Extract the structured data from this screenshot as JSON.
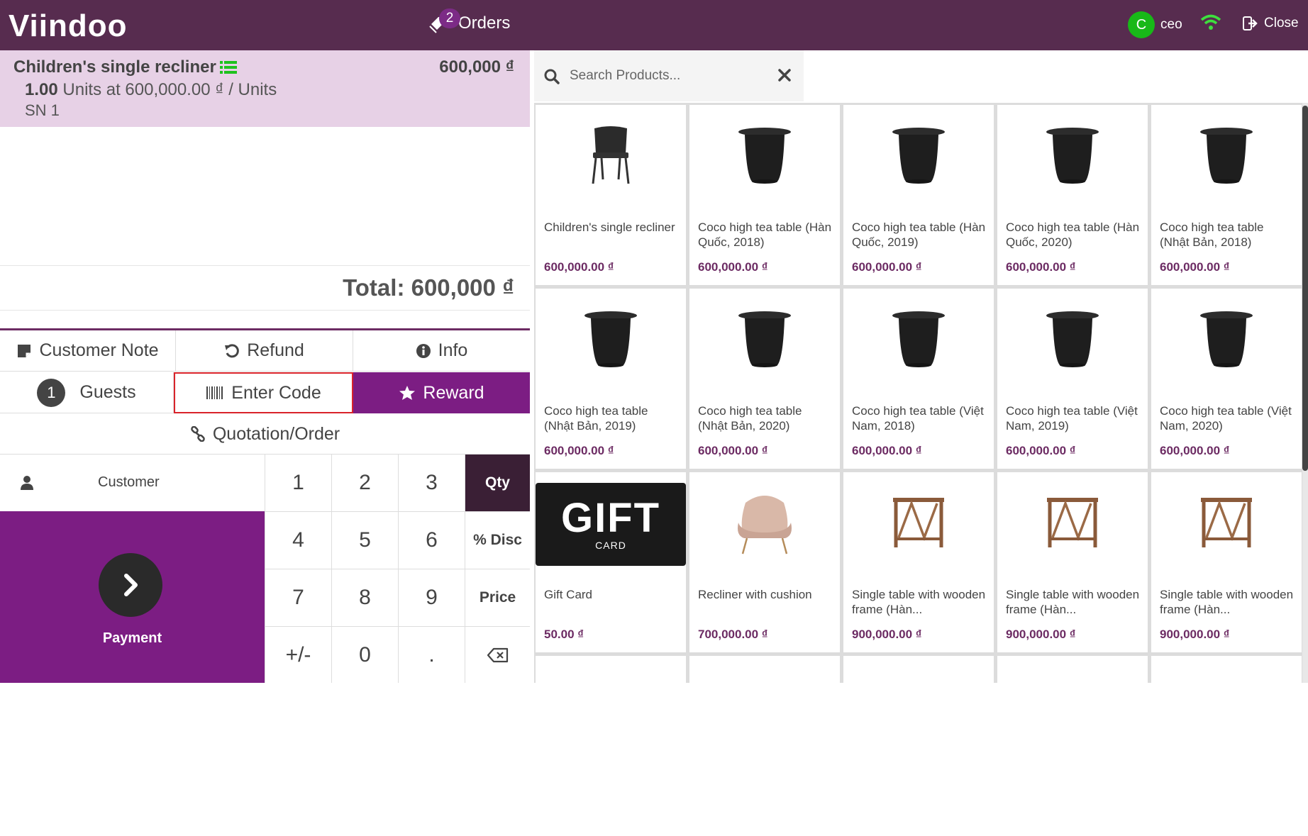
{
  "header": {
    "logo": "Viindoo",
    "orders_label": "Orders",
    "orders_count": "2",
    "user_initial": "C",
    "user_name": "ceo",
    "close_label": "Close"
  },
  "order": {
    "line_name": "Children's single recliner",
    "line_price": "600,000 ₫",
    "line_qty": "1.00",
    "line_detail": " Units at 600,000.00 ₫ / Units",
    "line_sn": "SN 1",
    "total": "Total: 600,000 ₫"
  },
  "controls": {
    "customer_note": "Customer Note",
    "refund": "Refund",
    "info": "Info",
    "guests_count": "1",
    "guests": "Guests",
    "enter_code": "Enter Code",
    "reward": "Reward",
    "quotation": "Quotation/Order"
  },
  "numpad": {
    "customer": "Customer",
    "payment": "Payment",
    "keys": [
      "1",
      "2",
      "3",
      "Qty",
      "4",
      "5",
      "6",
      "% Disc",
      "7",
      "8",
      "9",
      "Price",
      "+/-",
      "0",
      ".",
      ""
    ]
  },
  "search": {
    "placeholder": "Search Products..."
  },
  "products": [
    {
      "name": "Children's single recliner",
      "price": "600,000.00 ₫",
      "img": "chair"
    },
    {
      "name": "Coco high tea table (Hàn Quốc, 2018)",
      "price": "600,000.00 ₫",
      "img": "table"
    },
    {
      "name": "Coco high tea table (Hàn Quốc, 2019)",
      "price": "600,000.00 ₫",
      "img": "table"
    },
    {
      "name": "Coco high tea table (Hàn Quốc, 2020)",
      "price": "600,000.00 ₫",
      "img": "table"
    },
    {
      "name": "Coco high tea table (Nhật Bản, 2018)",
      "price": "600,000.00 ₫",
      "img": "table"
    },
    {
      "name": "Coco high tea table (Nhật Bản, 2019)",
      "price": "600,000.00 ₫",
      "img": "table"
    },
    {
      "name": "Coco high tea table (Nhật Bản, 2020)",
      "price": "600,000.00 ₫",
      "img": "table"
    },
    {
      "name": "Coco high tea table (Việt Nam, 2018)",
      "price": "600,000.00 ₫",
      "img": "table"
    },
    {
      "name": "Coco high tea table (Việt Nam, 2019)",
      "price": "600,000.00 ₫",
      "img": "table"
    },
    {
      "name": "Coco high tea table (Việt Nam, 2020)",
      "price": "600,000.00 ₫",
      "img": "table"
    },
    {
      "name": "Gift Card",
      "price": "50.00 ₫",
      "img": "gift",
      "gift_text": "GIFT",
      "gift_sub": "CARD"
    },
    {
      "name": "Recliner with cushion",
      "price": "700,000.00 ₫",
      "img": "armchair"
    },
    {
      "name": "Single table with wooden frame (Hàn...",
      "price": "900,000.00 ₫",
      "img": "frame"
    },
    {
      "name": "Single table with wooden frame (Hàn...",
      "price": "900,000.00 ₫",
      "img": "frame"
    },
    {
      "name": "Single table with wooden frame (Hàn...",
      "price": "900,000.00 ₫",
      "img": "frame"
    }
  ],
  "colors": {
    "topbar": "#572c4f",
    "accent": "#7c1d83",
    "orderline_bg": "#e7d1e6",
    "price": "#6c2b63",
    "highlight_border": "#d9232a"
  }
}
